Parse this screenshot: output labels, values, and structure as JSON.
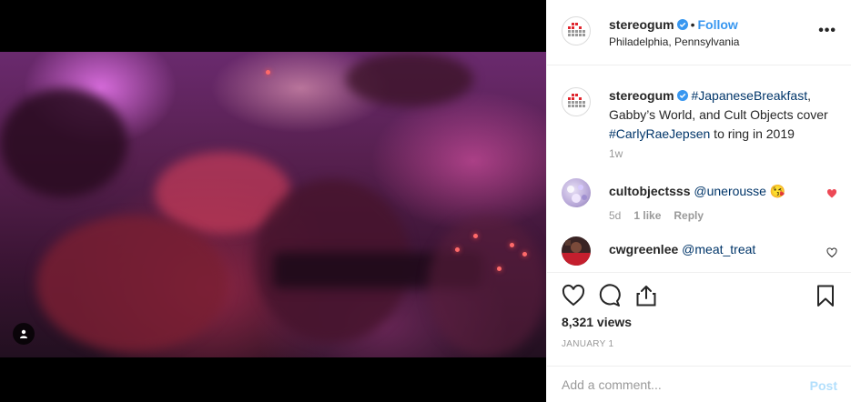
{
  "post": {
    "username": "stereogum",
    "follow_label": "Follow",
    "location": "Philadelphia, Pennsylvania",
    "more_icon": "ellipsis-icon"
  },
  "caption": {
    "username": "stereogum",
    "tag1": "#JapaneseBreakfast",
    "text1": ", Gabby’s World, and Cult Objects cover ",
    "tag2": "#CarlyRaeJepsen",
    "text2": " to ring in 2019",
    "time": "1w"
  },
  "comments": [
    {
      "username": "cultobjectsss",
      "mention": "@unerousse",
      "emoji": "😘",
      "age": "5d",
      "likes": "1 like",
      "reply": "Reply",
      "liked": true
    },
    {
      "username": "cwgreenlee",
      "mention": "@meat_treat",
      "liked": false
    }
  ],
  "stats": {
    "views": "8,321 views",
    "date": "JANUARY 1"
  },
  "composer": {
    "placeholder": "Add a comment...",
    "post_label": "Post"
  },
  "colors": {
    "link": "#003569",
    "follow": "#3897f0",
    "like_red": "#ed4956",
    "post_disabled": "#b2dffc",
    "logo_red": "#e0262e",
    "logo_gray": "#9a9a9a"
  }
}
